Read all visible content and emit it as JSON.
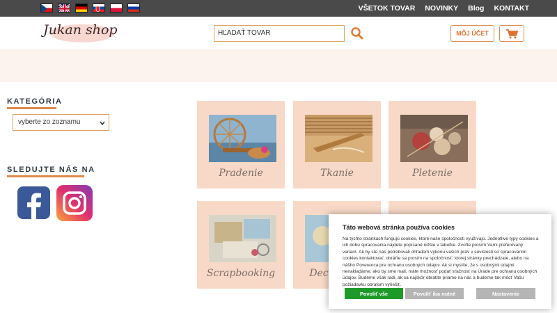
{
  "topbar": {
    "languages": [
      "Čeština",
      "English",
      "Deutsch",
      "Slovenčina",
      "Polski",
      "Русский"
    ],
    "nav": [
      "VŠETOK TOVAR",
      "NOVINKY",
      "Blog",
      "KONTAKT"
    ]
  },
  "header": {
    "logo_text": "Jukan shop",
    "search_placeholder": "HĽADAŤ TOVAR",
    "account_label": "MÔJ ÚČET",
    "icons": {
      "search": "search-icon",
      "cart": "cart-icon"
    }
  },
  "sidebar": {
    "category_title": "KATEGÓRIA",
    "category_select": "vyberte zo zoznamu",
    "follow_title": "SLEDUJTE NÁS NA",
    "social": [
      "facebook-icon",
      "instagram-icon"
    ]
  },
  "categories": [
    {
      "label": "Pradenie"
    },
    {
      "label": "Tkanie"
    },
    {
      "label": "Pletenie"
    },
    {
      "label": "Scrapbooking"
    },
    {
      "label": "Decoupage"
    },
    {
      "label": ""
    }
  ],
  "cookie": {
    "title": "Táto webová stránka používa cookies",
    "text": "Na týchto stránkach fungujú cookies, ktoré naše spoločnosti využívajú. Jednotlivé typy cookies a ich dobu spracovania nájdete popísané nižšie v tabuľke. Zvoľte prosím Vami preferovaný variant. Ak by ste nás potrebovali ohľadom výkonu vašich práv v súvislosti so spracovaním cookies kontaktovať, obráťte sa prosím na spoločnosť, ktorej stránky prechádzate, alebo na nášho Poverenca pre ochranu osobných údajov. Ak si myslíte, že s osobnými údajmi nenakladáme, ako by sme mali, máte možnosť podať sťažnosť na Úrade pre ochranu osobných údajov. Budeme však radi, ak sa najskôr obrátite priamo na nás a budeme tak môcť Vašu požiadavku obratom vyriešiť.",
    "allow_all": "Povoliť vše",
    "allow_necessary": "Povoliť iba nutné",
    "settings": "Nastavenie"
  },
  "colors": {
    "accent": "#e08a4a",
    "topbar": "#4a4a4a",
    "card": "#f8d9c7",
    "banner": "#fdf3ee",
    "allow_all": "#1e9a2b",
    "button_grey": "#b5b5b5"
  }
}
